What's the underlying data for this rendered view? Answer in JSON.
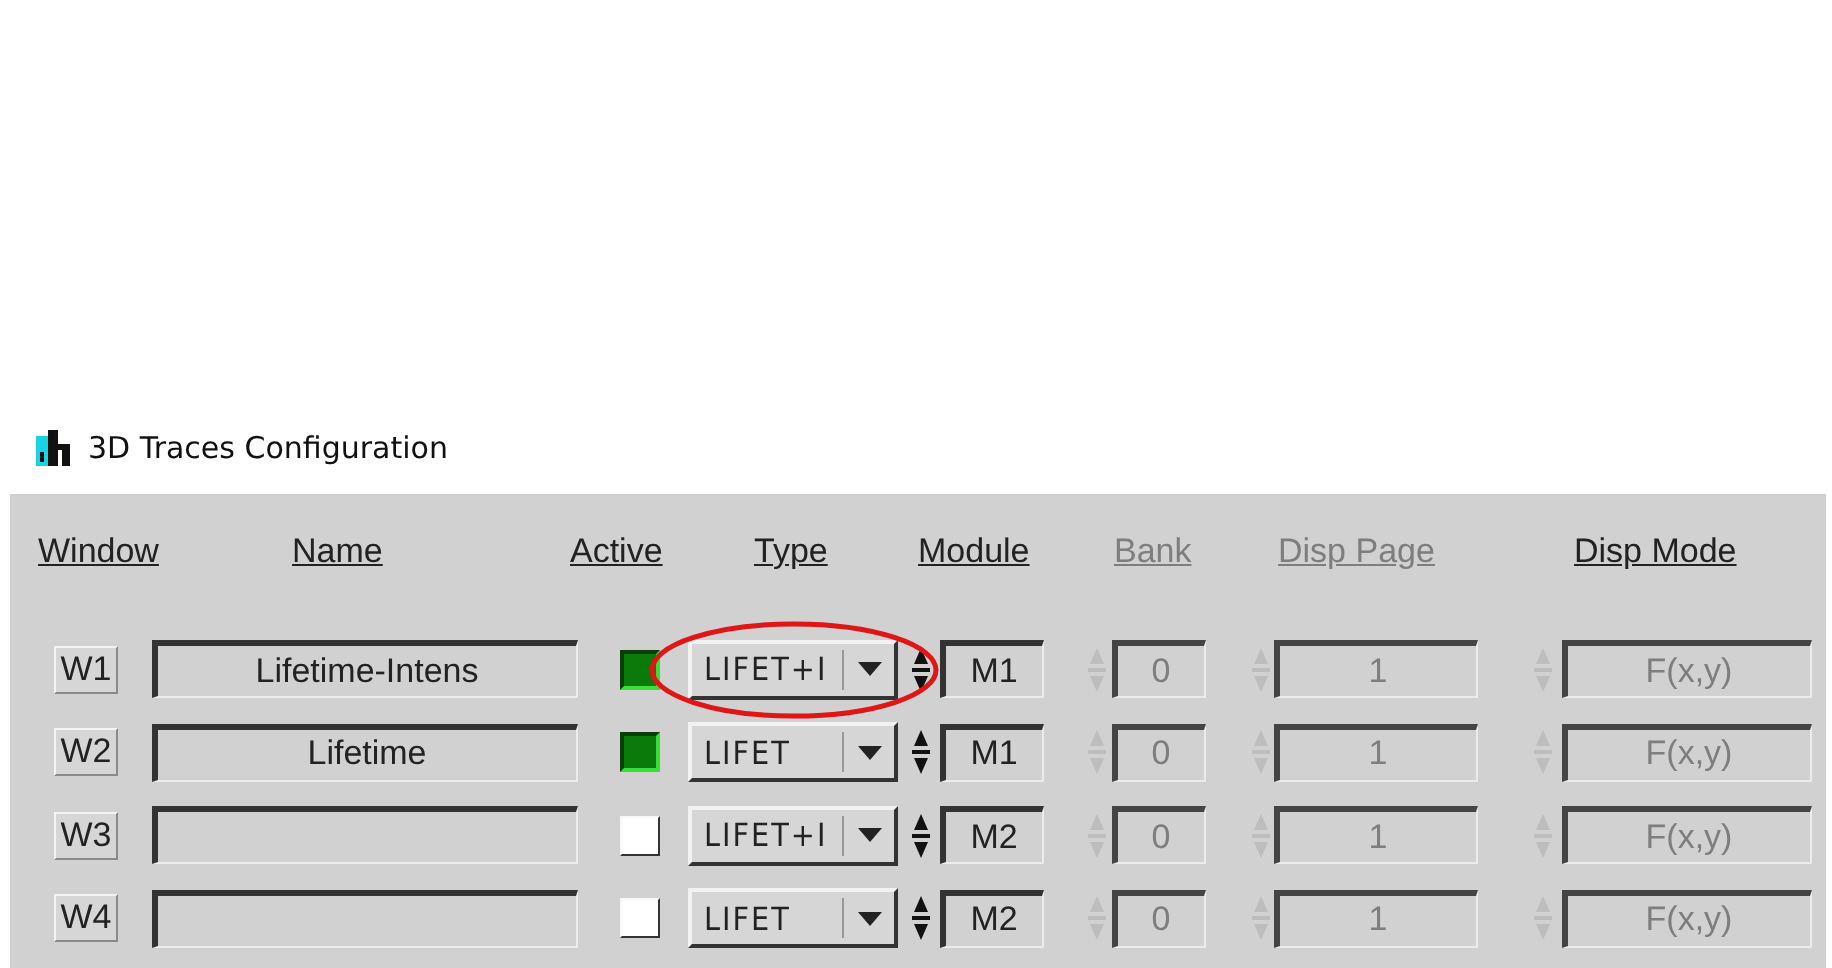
{
  "window": {
    "title": "3D Traces Configuration"
  },
  "columns": [
    {
      "label": "Window",
      "disabled": false
    },
    {
      "label": "Name",
      "disabled": false
    },
    {
      "label": "Active",
      "disabled": false
    },
    {
      "label": "Type",
      "disabled": false
    },
    {
      "label": "Module",
      "disabled": false,
      "cells_disabled": false
    },
    {
      "label": "Bank",
      "disabled": true,
      "cells_disabled": true
    },
    {
      "label": "Disp Page",
      "disabled": true,
      "cells_disabled": true
    },
    {
      "label": "Disp Mode",
      "disabled": false,
      "cells_disabled": true
    }
  ],
  "rows": [
    {
      "window": "W1",
      "name": "Lifetime-Intens",
      "active": true,
      "type": "LIFET+I",
      "module": "M1",
      "bank": "0",
      "disp_page": "1",
      "disp_mode": "F(x,y)",
      "highlighted": true
    },
    {
      "window": "W2",
      "name": "Lifetime",
      "active": true,
      "type": "LIFET",
      "module": "M1",
      "bank": "0",
      "disp_page": "1",
      "disp_mode": "F(x,y)",
      "highlighted": false
    },
    {
      "window": "W3",
      "active": false,
      "type": "LIFET+I",
      "module": "M2",
      "bank": "0",
      "disp_page": "1",
      "disp_mode": "F(x,y)",
      "highlighted": false
    },
    {
      "window": "W4",
      "active": false,
      "type": "LIFET",
      "module": "M2",
      "bank": "0",
      "disp_page": "1",
      "disp_mode": "F(x,y)",
      "highlighted": false
    }
  ]
}
